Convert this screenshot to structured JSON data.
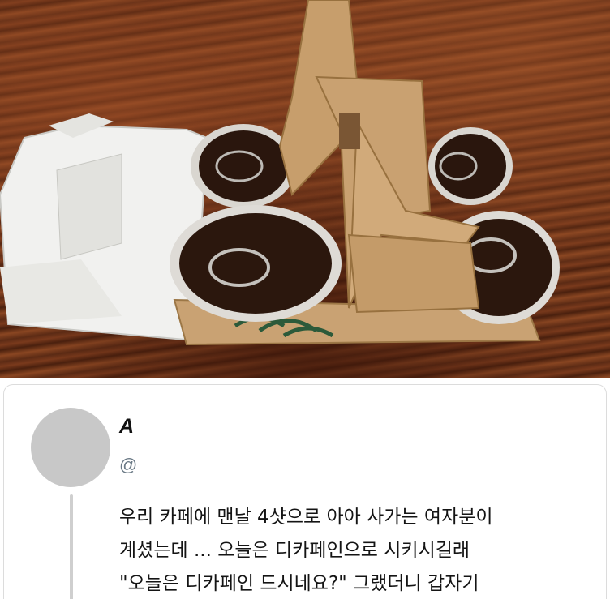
{
  "tweet": {
    "author_name": "A",
    "handle": "@",
    "text_lines": [
      "우리 카페에 맨날 4샷으로 아아 사가는 여자분이",
      "계셨는데 ... 오늘은 디카페인으로 시키시길래",
      "\"오늘은 디카페인 드시네요?\" 그랬더니 갑자기"
    ]
  },
  "colors": {
    "handle": "#6b7a86",
    "avatar": "#c8c8c8",
    "card_border": "#dcdcdc"
  }
}
